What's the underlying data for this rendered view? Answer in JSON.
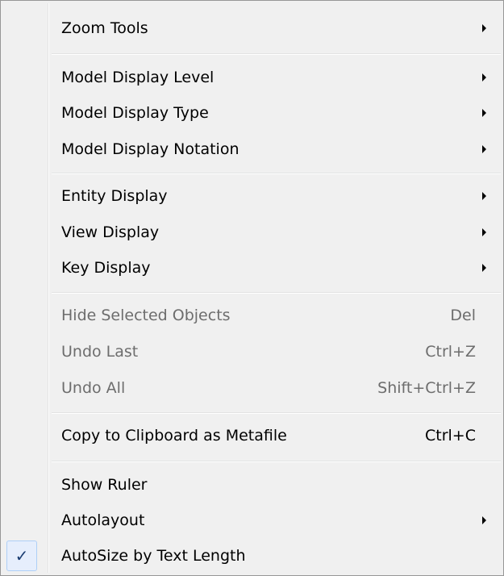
{
  "menu": {
    "items": [
      {
        "label": "Zoom Tools",
        "submenu": true
      },
      {
        "label": "Model Display Level",
        "submenu": true
      },
      {
        "label": "Model Display Type",
        "submenu": true
      },
      {
        "label": "Model Display Notation",
        "submenu": true
      },
      {
        "label": "Entity Display",
        "submenu": true
      },
      {
        "label": "View Display",
        "submenu": true
      },
      {
        "label": "Key Display",
        "submenu": true
      },
      {
        "label": "Hide Selected Objects",
        "shortcut": "Del",
        "disabled": true
      },
      {
        "label": "Undo Last",
        "shortcut": "Ctrl+Z",
        "disabled": true
      },
      {
        "label": "Undo All",
        "shortcut": "Shift+Ctrl+Z",
        "disabled": true
      },
      {
        "label": "Copy to Clipboard as Metafile",
        "shortcut": "Ctrl+C"
      },
      {
        "label": "Show Ruler"
      },
      {
        "label": "Autolayout",
        "submenu": true
      },
      {
        "label": "AutoSize by Text Length",
        "checked": true,
        "check_glyph": "✓"
      }
    ]
  },
  "colors": {
    "menu_background": "#f0f0f0",
    "menu_border": "#979797",
    "disabled_text": "#6d6d6d",
    "check_highlight": "#e6eefc",
    "check_mark": "#1b3d72"
  },
  "icons": {
    "submenu": "submenu-arrow-icon",
    "check": "checkmark-icon"
  }
}
